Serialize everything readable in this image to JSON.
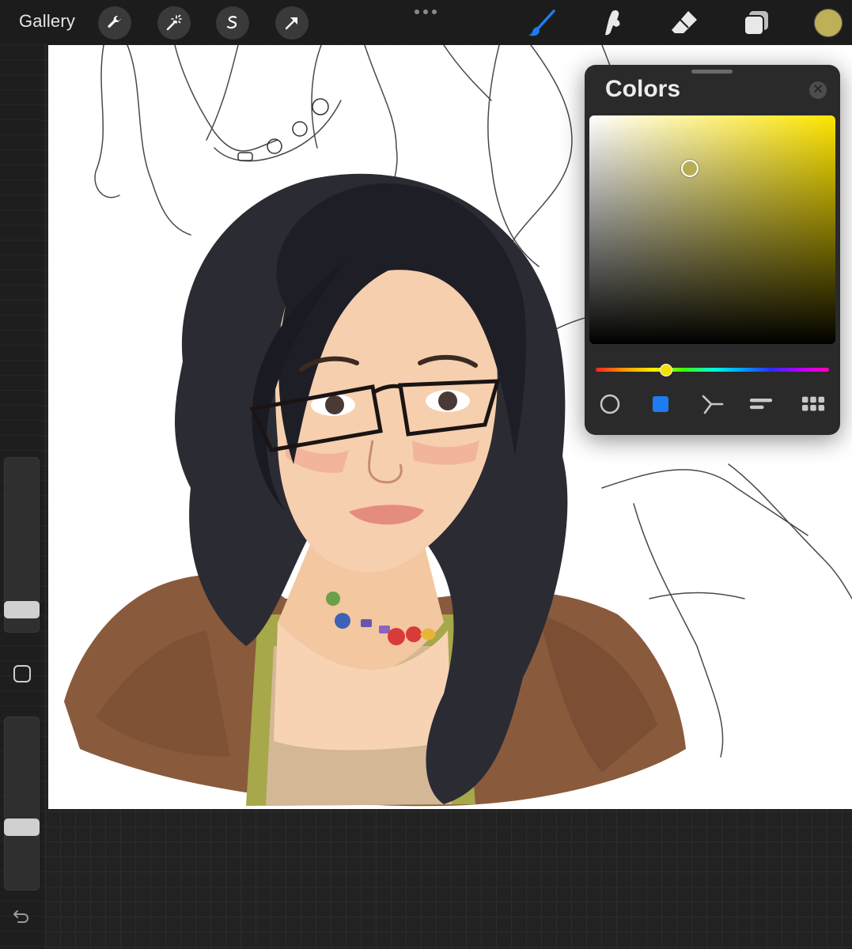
{
  "toolbar": {
    "gallery_label": "Gallery",
    "left_tools": [
      "wrench-icon",
      "magic-wand-icon",
      "selection-icon",
      "transform-arrow-icon"
    ],
    "right_tools": [
      "brush-icon",
      "smudge-icon",
      "eraser-icon",
      "layers-icon"
    ],
    "active_tool": "brush-icon",
    "active_color": "#bdb058",
    "accent_color": "#1e7cf2"
  },
  "sidebar": {
    "brush_size_level": 0.0,
    "opacity_level": 0.0,
    "controls": [
      "modify-square-icon",
      "undo-icon"
    ]
  },
  "colors_panel": {
    "title": "Colors",
    "selected_color": "#b7ad55",
    "hue_color": "#ffe500",
    "tabs": [
      "disc-icon",
      "classic-icon",
      "harmony-icon",
      "value-icon",
      "palettes-icon"
    ],
    "active_tab": "classic-icon"
  },
  "canvas": {
    "subject": "digital-painting-portrait"
  }
}
